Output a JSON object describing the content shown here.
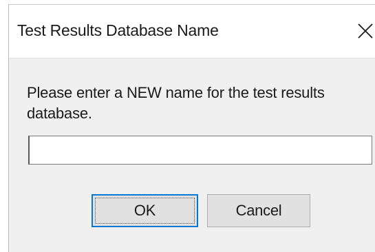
{
  "dialog": {
    "title": "Test Results Database Name",
    "close_icon": "close-icon",
    "prompt": "Please enter a NEW name for the test results database.",
    "input": {
      "value": "",
      "placeholder": ""
    },
    "buttons": {
      "ok_label": "OK",
      "cancel_label": "Cancel"
    }
  },
  "colors": {
    "window_background": "#f0f0f0",
    "titlebar_background": "#ffffff",
    "default_button_border": "#0078d7",
    "button_face": "#e1e1e1"
  }
}
